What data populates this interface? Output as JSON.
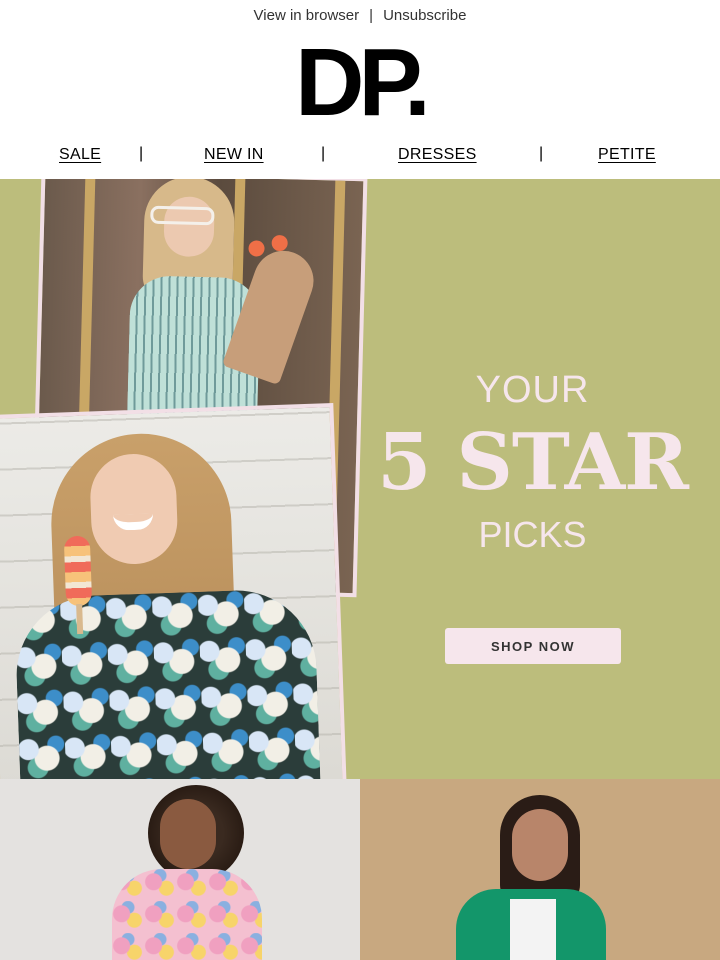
{
  "header": {
    "view_in_browser": "View in browser",
    "separator": "|",
    "unsubscribe": "Unsubscribe"
  },
  "brand": {
    "logo_text": "DP."
  },
  "nav": {
    "items": [
      {
        "label": "SALE"
      },
      {
        "label": "NEW IN"
      },
      {
        "label": "DRESSES"
      },
      {
        "label": "PETITE"
      }
    ],
    "separator": "|"
  },
  "hero": {
    "line1": "YOUR",
    "line2": "5 STAR",
    "line3": "PICKS",
    "cta_label": "SHOP NOW",
    "background_color": "#bcbd7c",
    "accent_color": "#f6e6ec"
  },
  "products": [
    {
      "image": "woman-floral-dress"
    },
    {
      "image": "woman-green-blazer"
    }
  ]
}
